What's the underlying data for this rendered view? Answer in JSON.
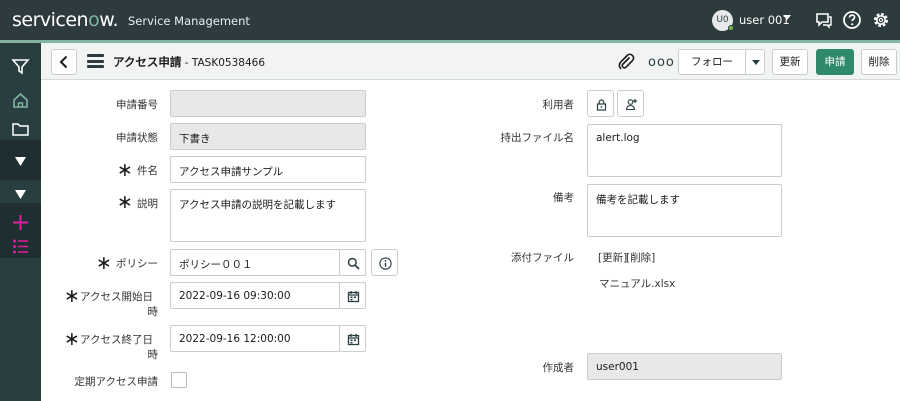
{
  "topbar": {
    "brand_prefix": "servicen",
    "brand_o": "o",
    "brand_suffix": "w.",
    "product": "Service Management",
    "avatar_initials": "U0",
    "user_name": "user 001"
  },
  "header": {
    "title": "アクセス申請",
    "record_number": " - TASK0538466",
    "more_label": "ooo",
    "follow_label": "フォロー",
    "update_label": "更新",
    "submit_label": "申請",
    "delete_label": "削除"
  },
  "form": {
    "required_mark": "∗",
    "request_number": {
      "label": "申請番号",
      "value": ""
    },
    "request_status": {
      "label": "申請状態",
      "value": "下書き"
    },
    "subject": {
      "label": "件名",
      "value": "アクセス申請サンプル"
    },
    "description": {
      "label": "説明",
      "value": "アクセス申請の説明を記載します"
    },
    "policy": {
      "label": "ポリシー",
      "value": "ポリシー００１"
    },
    "access_start": {
      "label_line1": "アクセス開始日",
      "label_line2": "時",
      "value": "2022-09-16 09:30:00"
    },
    "access_end": {
      "label_line1": "アクセス終了日",
      "label_line2": "時",
      "value": "2022-09-16 12:00:00"
    },
    "periodic_access": {
      "label": "定期アクセス申請"
    },
    "user": {
      "label": "利用者"
    },
    "export_file_name": {
      "label": "持出ファイル名",
      "value": "alert.log"
    },
    "remarks": {
      "label": "備考",
      "value": "備考を記載します"
    },
    "attachment": {
      "label": "添付ファイル",
      "update_link": "[更新]",
      "delete_link": "[削除]",
      "file_name": "マニュアル.xlsx"
    },
    "creator": {
      "label": "作成者",
      "value": "user001"
    }
  },
  "colors": {
    "topbar": "#2d3b3f",
    "sidenav": "#293e40",
    "accent": "#81b5a1",
    "submit": "#2e8a6b",
    "nav_pink": "#e31ca0"
  }
}
